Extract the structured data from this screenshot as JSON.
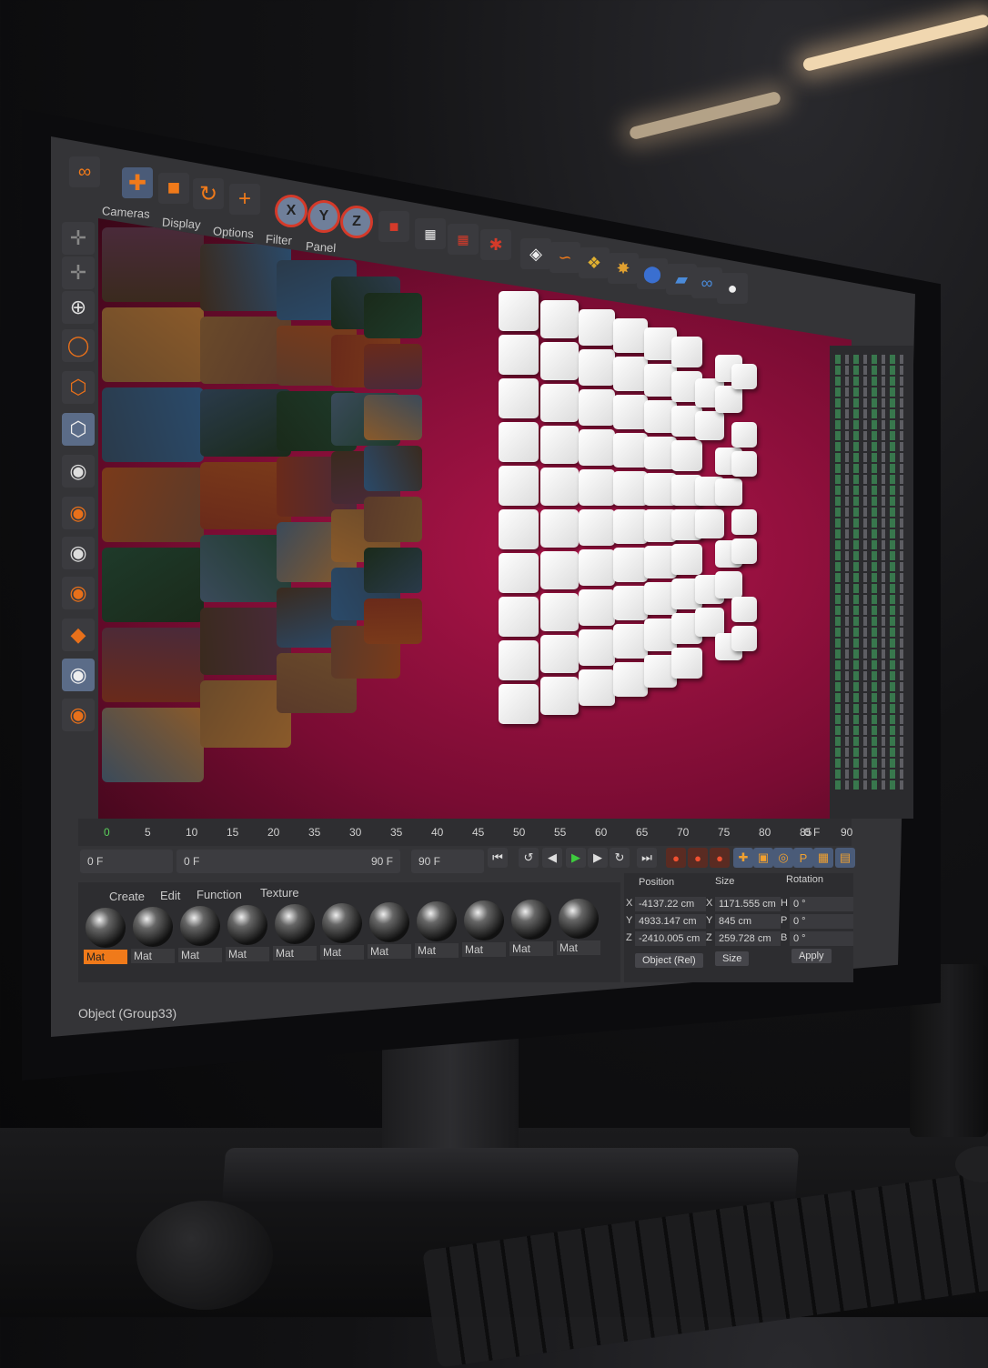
{
  "toolbar": {
    "menus": [
      "Cameras",
      "Display",
      "Options",
      "Filter",
      "Panel"
    ],
    "axis_buttons": [
      "X",
      "Y",
      "Z"
    ],
    "icons": [
      "logo-icon",
      "move-icon",
      "cube-icon",
      "rotate-icon",
      "add-icon"
    ]
  },
  "timeline": {
    "ticks": [
      "0",
      "5",
      "10",
      "15",
      "20",
      "35",
      "30",
      "35",
      "40",
      "45",
      "50",
      "55",
      "60",
      "65",
      "70",
      "75",
      "80",
      "85",
      "90"
    ],
    "end_label": "0 F"
  },
  "transport": {
    "current_frame": "0 F",
    "range_start": "0 F",
    "range_end": "90 F",
    "max_frame": "90 F"
  },
  "materials": {
    "menus": [
      "Create",
      "Edit",
      "Function",
      "Texture"
    ],
    "items": [
      "Mat",
      "Mat",
      "Mat",
      "Mat",
      "Mat",
      "Mat",
      "Mat",
      "Mat",
      "Mat",
      "Mat",
      "Mat"
    ]
  },
  "coordinates": {
    "headers": {
      "position": "Position",
      "size": "Size",
      "rotation": "Rotation"
    },
    "rows": [
      {
        "axis": "X",
        "position": "-4137.22 cm",
        "size_axis": "X",
        "size": "1171.555 cm",
        "rot_axis": "H",
        "rotation": "0 °"
      },
      {
        "axis": "Y",
        "position": "4933.147 cm",
        "size_axis": "Y",
        "size": "845 cm",
        "rot_axis": "P",
        "rotation": "0 °"
      },
      {
        "axis": "Z",
        "position": "-2410.005 cm",
        "size_axis": "Z",
        "size": "259.728 cm",
        "rot_axis": "B",
        "rotation": "0 °"
      }
    ],
    "mode": "Object (Rel)",
    "size_mode": "Size",
    "apply": "Apply"
  },
  "status": {
    "object": "Object (Group33)"
  },
  "colors": {
    "accent": "#f07a1a",
    "viewport_bg": "#a0123f",
    "ui_bg": "#343437"
  }
}
